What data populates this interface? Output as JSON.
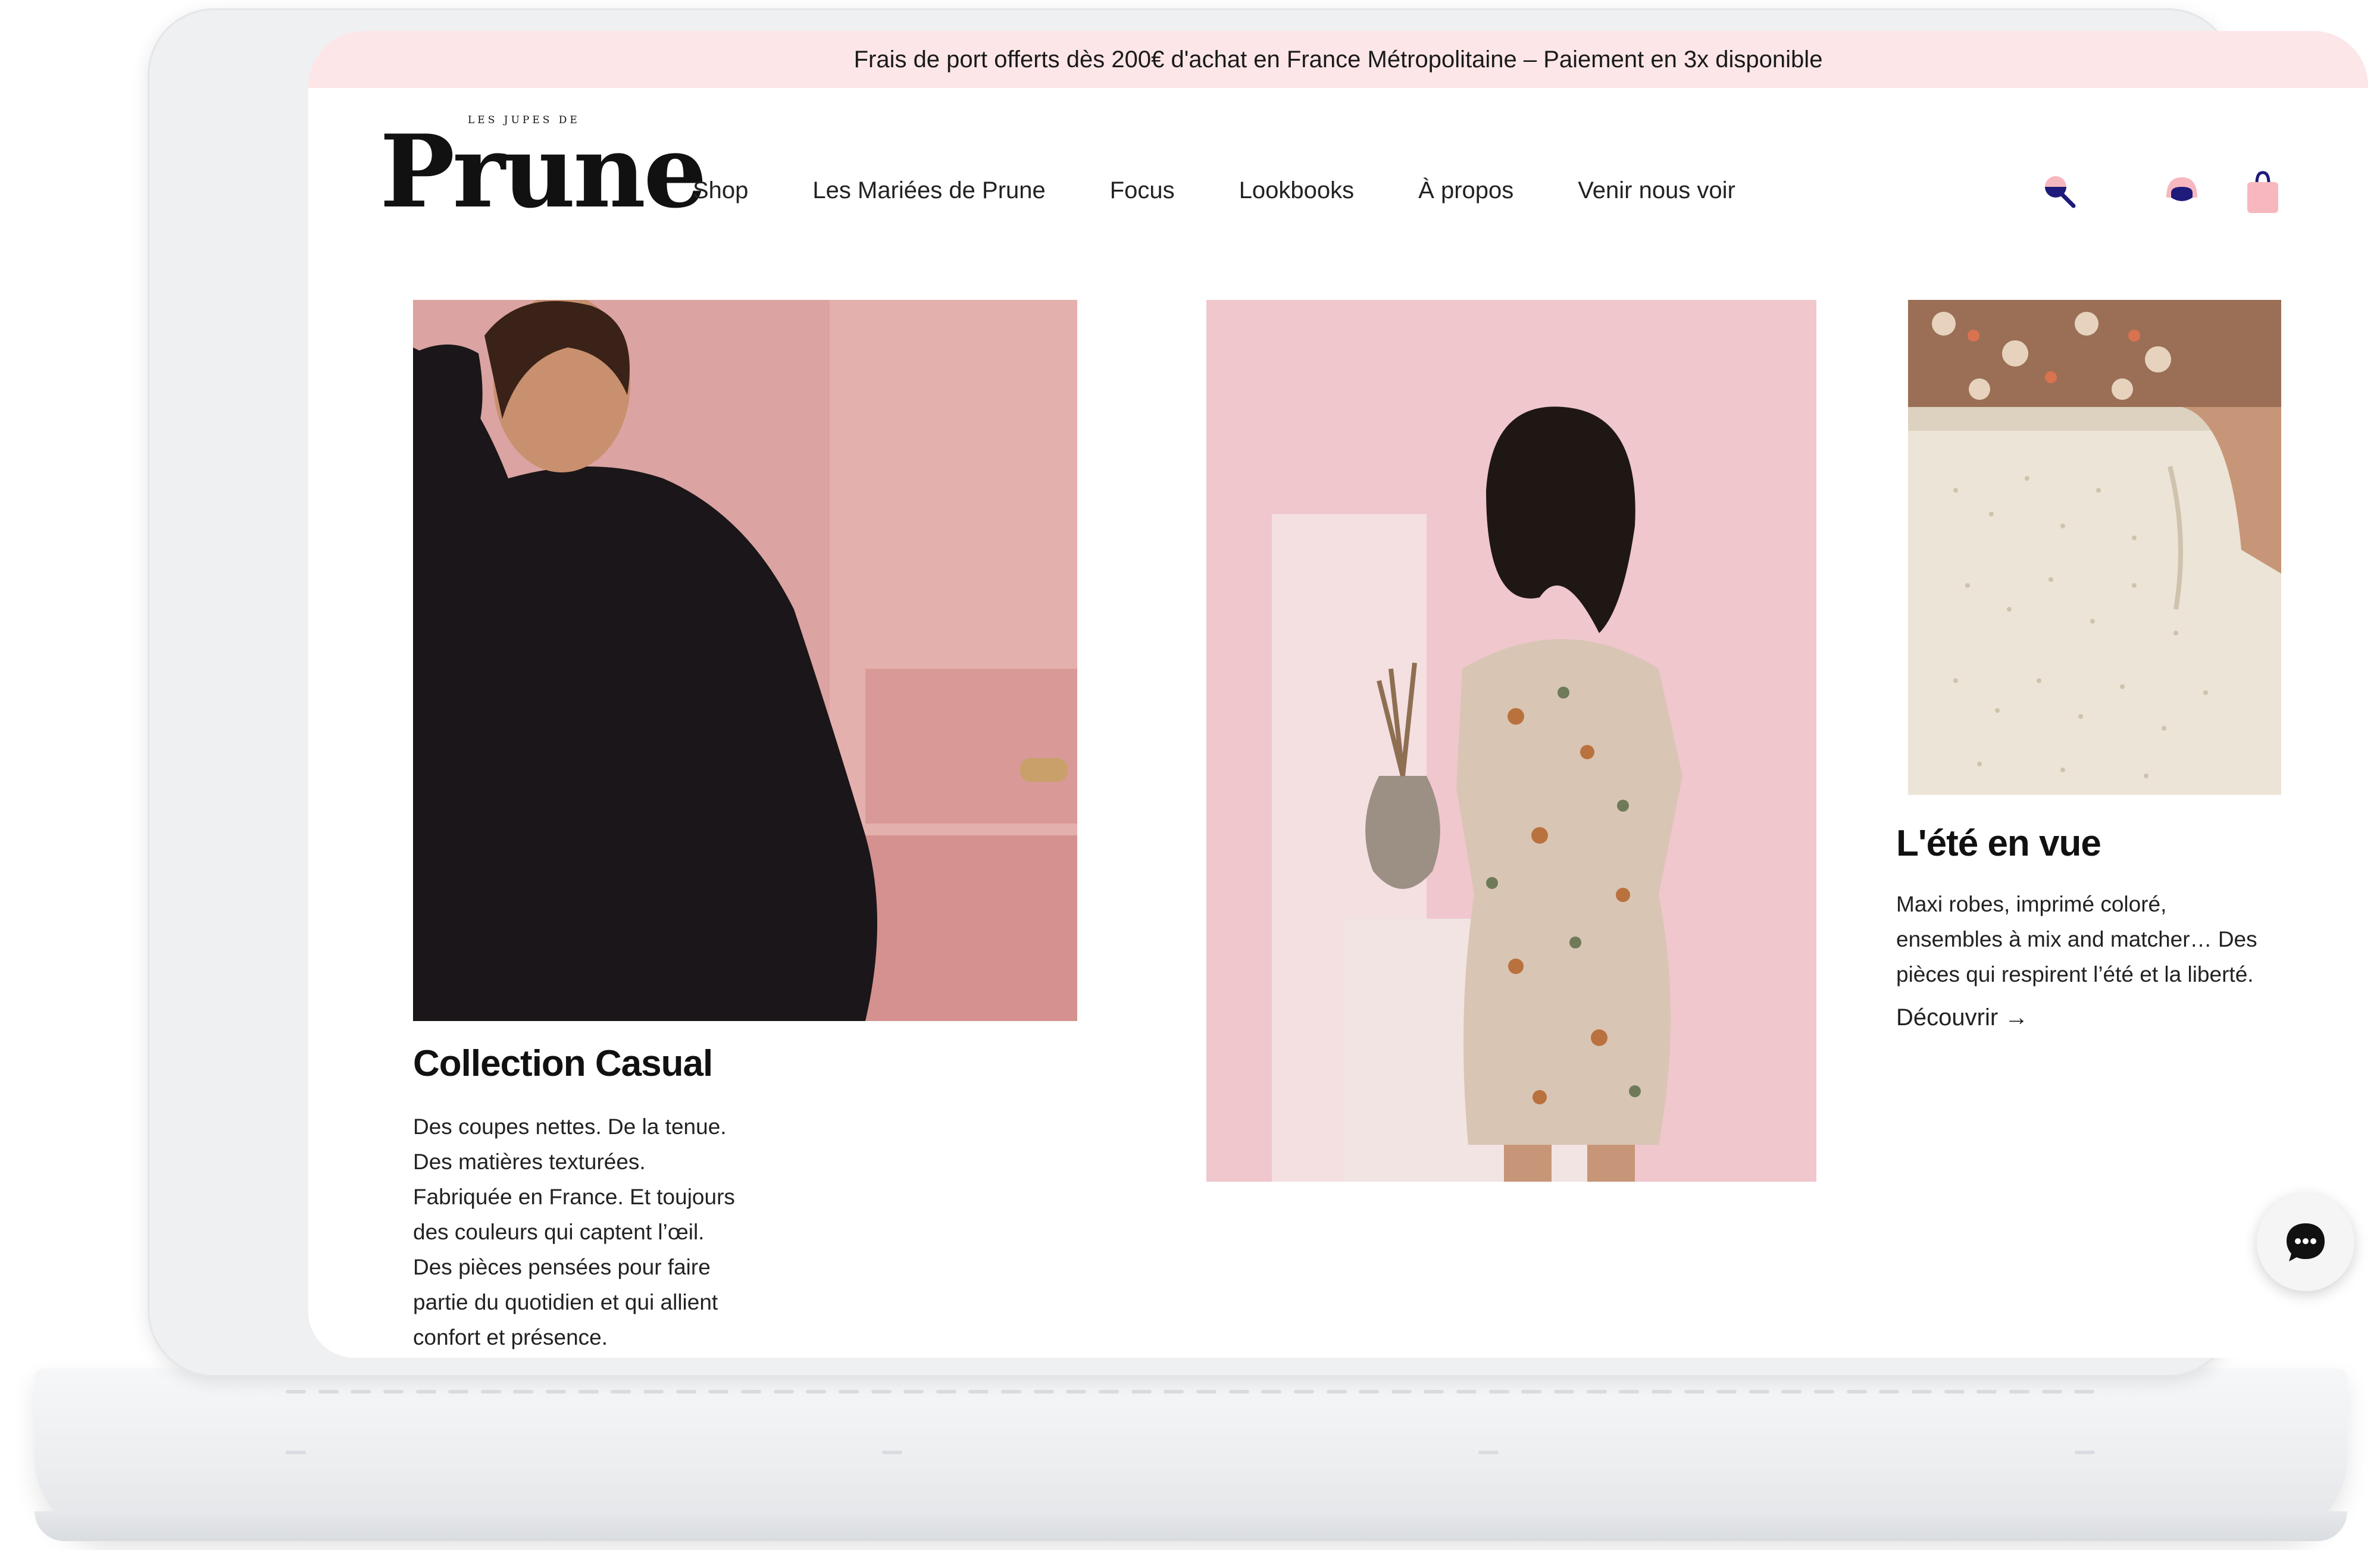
{
  "banner": {
    "text": "Frais de port offerts dès 200€ d'achat en France Métropolitaine – Paiement en 3x disponible"
  },
  "logo": {
    "tagline": "LES JUPES DE",
    "name": "Prune"
  },
  "nav": {
    "items": [
      "Shop",
      "Les Mariées de Prune",
      "Focus",
      "Lookbooks",
      "À propos",
      "Venir nous voir"
    ]
  },
  "icons": {
    "search": "search-icon",
    "account": "account-icon",
    "cart": "shopping-bag-icon"
  },
  "colors": {
    "banner_bg": "#fde6e8",
    "accent_pink": "#f6b8be",
    "accent_navy": "#1f1b7a"
  },
  "sections": {
    "casual": {
      "title": "Collection Casual",
      "description": "Des coupes nettes. De la tenue. Des matières texturées. Fabriquée en France. Et toujours des couleurs qui captent l’œil. Des pièces pensées pour faire partie du quotidien et qui allient confort et présence."
    },
    "ete": {
      "title": "L'été en vue",
      "description": "Maxi robes, imprimé coloré, ensembles à mix and matcher… Des pièces qui respirent l’été et la liberté.",
      "link": "Découvrir →"
    }
  },
  "chat": {
    "icon": "chat-bubble-icon"
  }
}
